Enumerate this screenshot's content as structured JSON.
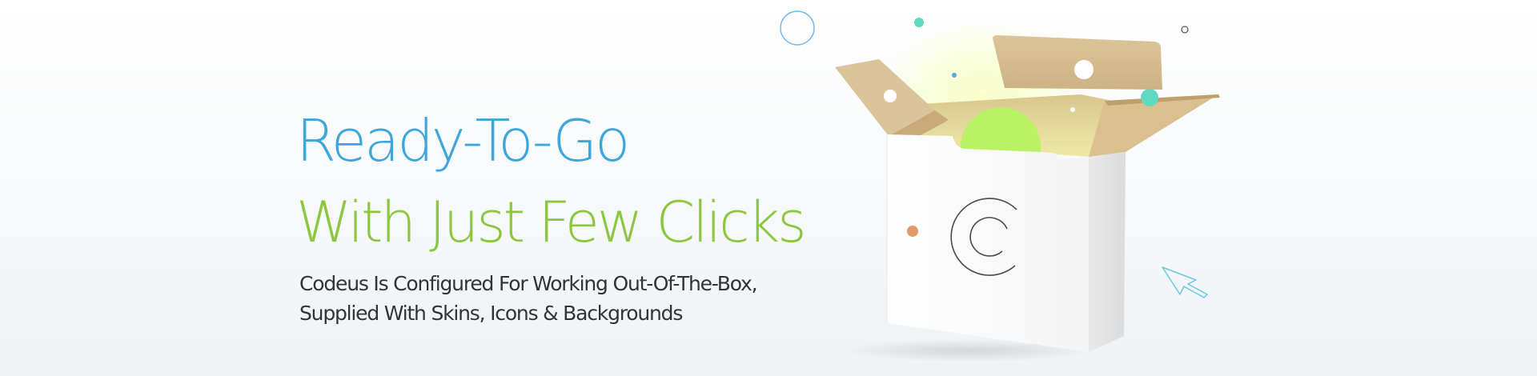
{
  "hero": {
    "headline_line1": "Ready-To-Go",
    "headline_line2": "With Just Few Clicks",
    "description_line1": "Codeus Is Configured For Working Out-Of-The-Box,",
    "description_line2": "Supplied With Skins, Icons & Backgrounds"
  },
  "colors": {
    "headline_blue": "#3da7dc",
    "headline_green": "#8dc63f",
    "body_text": "#333333",
    "teal_accent": "#5fdac0",
    "orange_accent": "#e09a6c",
    "lime_glow": "#b9f264"
  },
  "icons": {
    "box": "open-cardboard-box",
    "logo": "spiral-c-logo-icon",
    "cursor": "mouse-pointer-arrow-icon"
  }
}
